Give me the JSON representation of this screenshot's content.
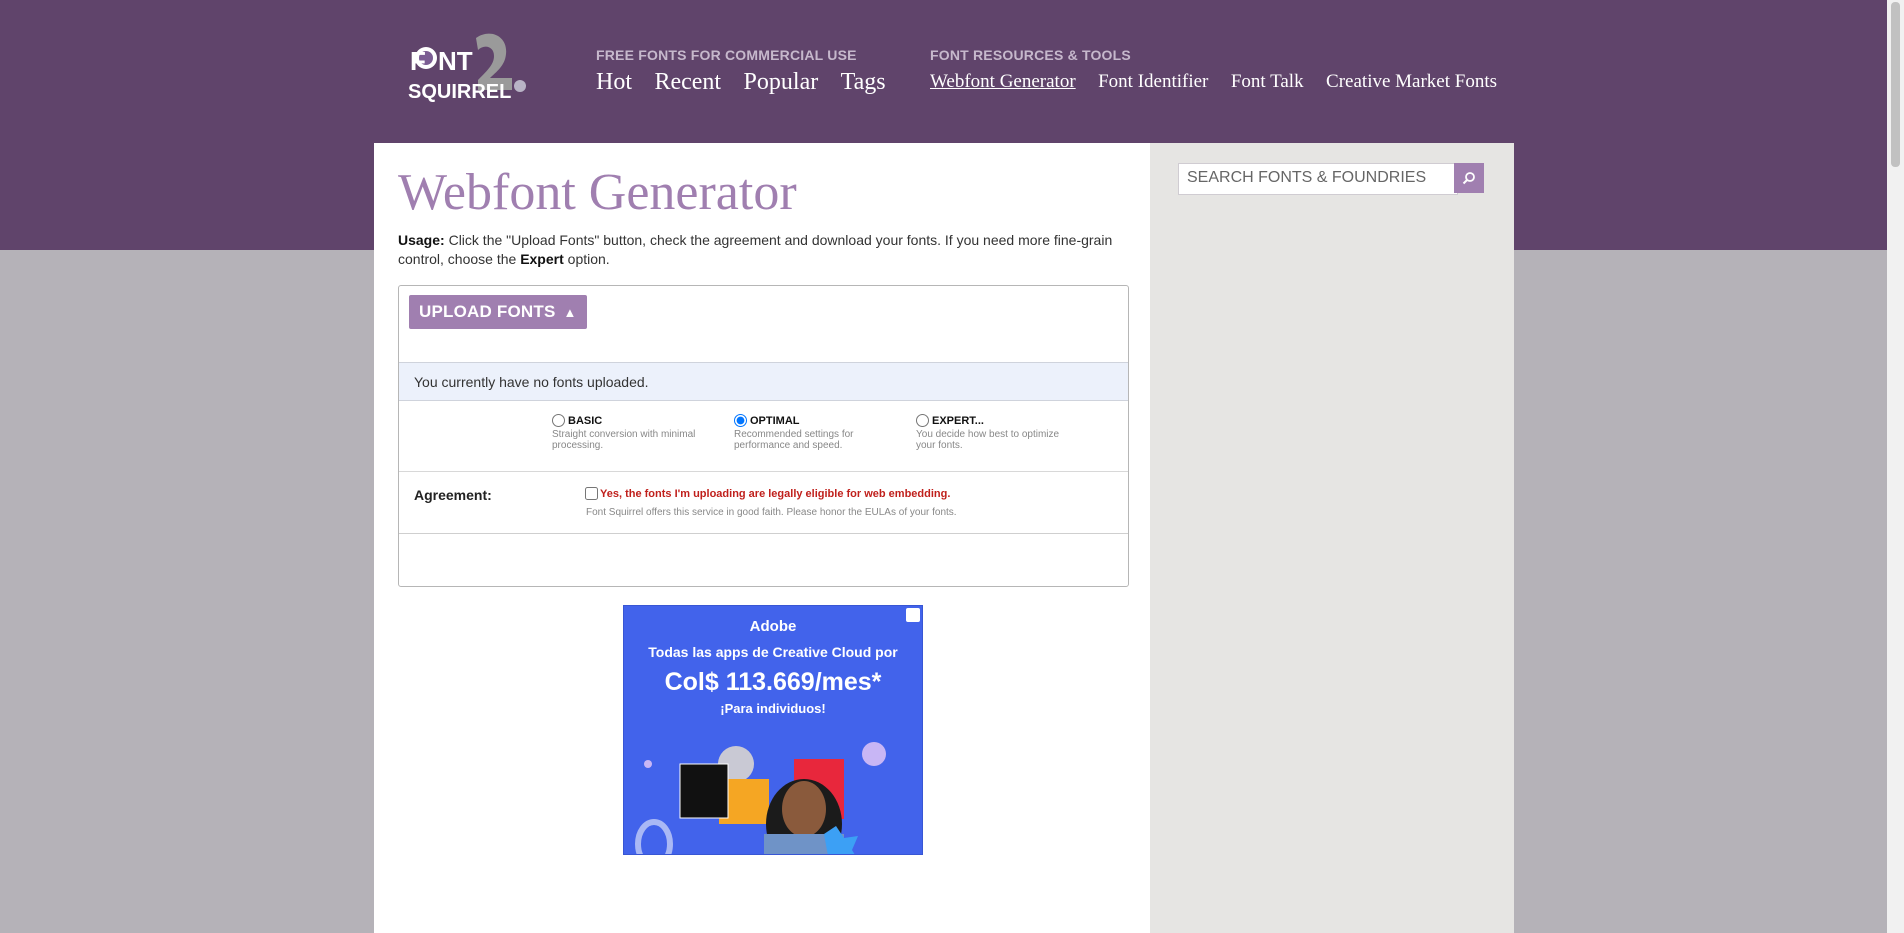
{
  "header": {
    "logo_alt": "Font Squirrel",
    "free_fonts": {
      "heading": "FREE FONTS FOR COMMERCIAL USE",
      "links": [
        "Hot",
        "Recent",
        "Popular",
        "Tags"
      ]
    },
    "resources": {
      "heading": "FONT RESOURCES & TOOLS",
      "links": [
        "Webfont Generator",
        "Font Identifier",
        "Font Talk",
        "Creative Market Fonts"
      ],
      "active": "Webfont Generator"
    }
  },
  "search": {
    "placeholder": "SEARCH FONTS & FOUNDRIES"
  },
  "main": {
    "title": "Webfont Generator",
    "usage_label": "Usage:",
    "usage_text1": " Click the \"Upload Fonts\" button, check the agreement and download your fonts. If you need more fine-grain control, choose the ",
    "usage_bold": "Expert",
    "usage_text2": " option."
  },
  "panel": {
    "upload_label": "UPLOAD FONTS",
    "status": "You currently have no fonts uploaded.",
    "modes": [
      {
        "label": "BASIC",
        "desc": "Straight conversion with minimal processing.",
        "checked": false
      },
      {
        "label": "OPTIMAL",
        "desc": "Recommended settings for performance and speed.",
        "checked": true
      },
      {
        "label": "EXPERT...",
        "desc": "You decide how best to optimize your fonts.",
        "checked": false
      }
    ],
    "agreement_label": "Agreement:",
    "agreement_text": "Yes, the fonts I'm uploading are legally eligible for web embedding.",
    "agreement_note": "Font Squirrel offers this service in good faith. Please honor the EULAs of your fonts."
  },
  "ad": {
    "brand": "Adobe",
    "line1": "Todas las apps de Creative Cloud por",
    "price": "Col$ 113.669/mes*",
    "sub": "¡Para individuos!",
    "accent": "#4263eb"
  },
  "colors": {
    "header_bg": "#60446b",
    "accent": "#a07fb0",
    "page_bg": "#b5b2b8",
    "warning": "#c0201c"
  }
}
